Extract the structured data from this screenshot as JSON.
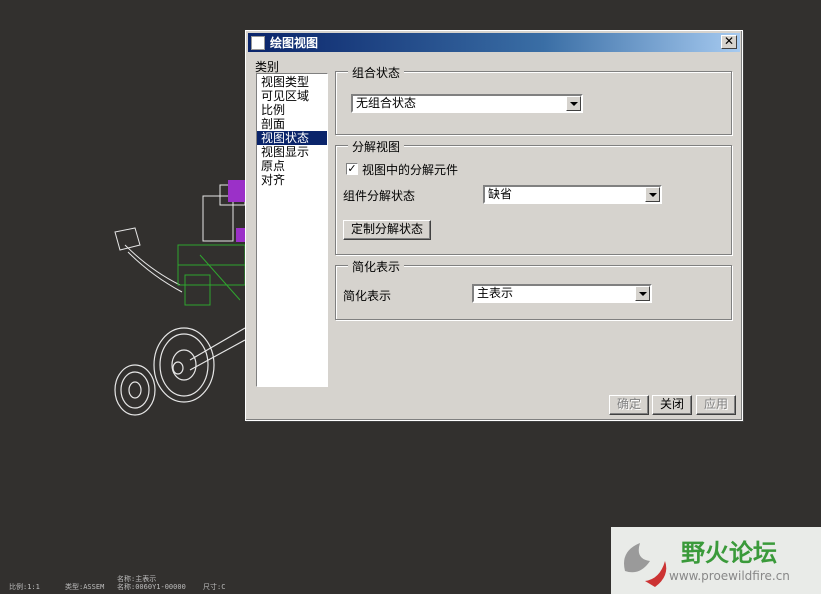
{
  "dialog": {
    "title": "绘图视图",
    "close_glyph": "✕",
    "category_label": "类别",
    "categories": [
      "视图类型",
      "可见区域",
      "比例",
      "剖面",
      "视图状态",
      "视图显示",
      "原点",
      "对齐"
    ],
    "selected_category_index": 4
  },
  "combined_state": {
    "legend": "组合状态",
    "value": "无组合状态"
  },
  "explode_view": {
    "legend": "分解视图",
    "checkbox_label": "视图中的分解元件",
    "checked": true,
    "check_glyph": "✓",
    "component_state_label": "组件分解状态",
    "component_state_value": "缺省",
    "custom_button": "定制分解状态"
  },
  "simplified": {
    "legend": "简化表示",
    "label": "简化表示",
    "value": "主表示"
  },
  "buttons": {
    "ok": "确定",
    "close": "关闭",
    "apply": "应用"
  },
  "status_bar": {
    "scale": "比例:1:1",
    "type": "类型:ASSEM",
    "name_top": "名称:主表示",
    "name": "名称:0060Y1-00000",
    "size": "尺寸:C"
  },
  "watermark": {
    "title": "野火论坛",
    "url": "www.proewildfire.cn"
  },
  "colors": {
    "background": "#32302e",
    "dialog_face": "#d6d3ce",
    "titlebar": "#0a246a",
    "selection": "#0a246a",
    "model_green": "#2fa52f",
    "model_purple": "#9b30c8",
    "watermark_green": "#3a9a3a"
  }
}
